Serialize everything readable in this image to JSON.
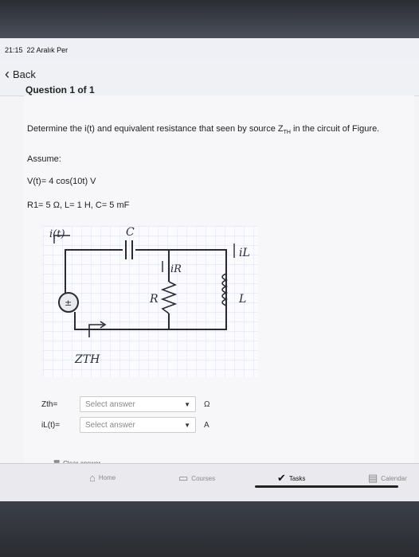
{
  "status": {
    "time": "21:15",
    "date": "22 Aralık Per"
  },
  "nav": {
    "back_label": "Back"
  },
  "question": {
    "header": "Question 1 of 1",
    "prompt": "Determine the i(t) and equivalent resistance that seen by source Z",
    "prompt_sub": "TH",
    "prompt_end": " in the circuit of Figure.",
    "assume": "Assume:",
    "vt": "V(t)= 4 cos(10t) V",
    "params": "R1= 5 Ω, L= 1 H, C= 5 mF"
  },
  "figure": {
    "labels": {
      "i": "i(t)",
      "c": "C",
      "ir": "iR",
      "il": "iL",
      "r": "R",
      "l": "L",
      "zth": "ZTH"
    }
  },
  "answers": [
    {
      "label": "Zth=",
      "placeholder": "Select answer",
      "unit": "Ω"
    },
    {
      "label": "iL(t)=",
      "placeholder": "Select answer",
      "unit": "A"
    }
  ],
  "clear_label": "Clear answer",
  "tabs": [
    {
      "label": "Home",
      "icon": "home-icon"
    },
    {
      "label": "Courses",
      "icon": "courses-icon"
    },
    {
      "label": "Tasks",
      "icon": "check-icon"
    },
    {
      "label": "Calendar",
      "icon": "calendar-icon"
    }
  ]
}
